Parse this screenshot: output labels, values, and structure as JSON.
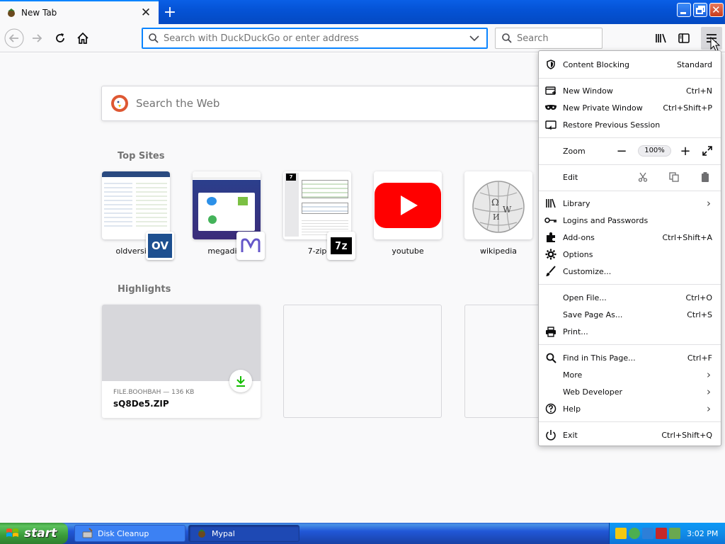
{
  "tab": {
    "title": "New Tab"
  },
  "navbar": {
    "url_placeholder": "Search with DuckDuckGo or enter address",
    "search_placeholder": "Search"
  },
  "content": {
    "web_search_placeholder": "Search the Web",
    "top_sites_title": "Top Sites",
    "top_sites": [
      {
        "label": "oldversion",
        "badge": "OV"
      },
      {
        "label": "megadisk"
      },
      {
        "label": "7-zip",
        "badge": "7z"
      },
      {
        "label": "youtube"
      },
      {
        "label": "wikipedia"
      }
    ],
    "highlights_title": "Highlights",
    "highlight": {
      "source": "FILE.BOOHBAH — 136 KB",
      "filename": "sQ8De5.ZIP"
    }
  },
  "menu": {
    "content_blocking": {
      "label": "Content Blocking",
      "value": "Standard"
    },
    "new_window": {
      "label": "New Window",
      "shortcut": "Ctrl+N"
    },
    "new_private": {
      "label": "New Private Window",
      "shortcut": "Ctrl+Shift+P"
    },
    "restore": {
      "label": "Restore Previous Session"
    },
    "zoom": {
      "label": "Zoom",
      "value": "100%"
    },
    "edit": {
      "label": "Edit"
    },
    "library": {
      "label": "Library"
    },
    "logins": {
      "label": "Logins and Passwords"
    },
    "addons": {
      "label": "Add-ons",
      "shortcut": "Ctrl+Shift+A"
    },
    "options": {
      "label": "Options"
    },
    "customize": {
      "label": "Customize..."
    },
    "open_file": {
      "label": "Open File...",
      "shortcut": "Ctrl+O"
    },
    "save_page": {
      "label": "Save Page As...",
      "shortcut": "Ctrl+S"
    },
    "print": {
      "label": "Print..."
    },
    "find": {
      "label": "Find in This Page...",
      "shortcut": "Ctrl+F"
    },
    "more": {
      "label": "More"
    },
    "web_developer": {
      "label": "Web Developer"
    },
    "help": {
      "label": "Help"
    },
    "exit": {
      "label": "Exit",
      "shortcut": "Ctrl+Shift+Q"
    }
  },
  "taskbar": {
    "start_label": "start",
    "tasks": [
      {
        "label": "Disk Cleanup"
      },
      {
        "label": "Mypal"
      }
    ],
    "clock": "3:02 PM"
  }
}
